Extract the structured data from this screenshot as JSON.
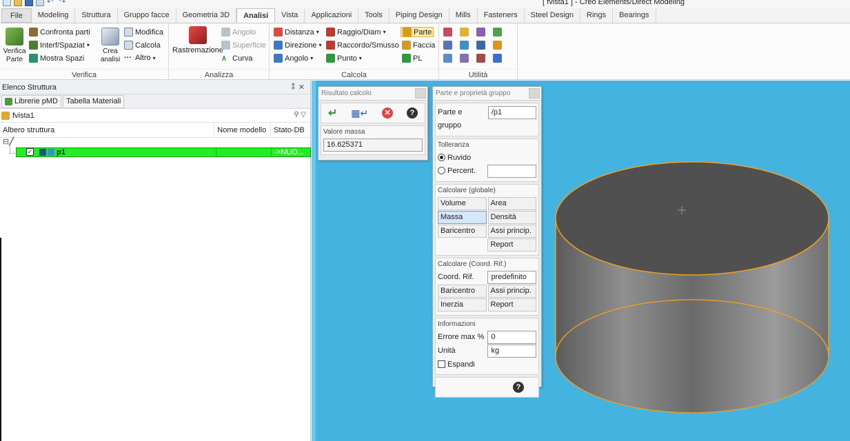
{
  "window": {
    "title": "[ fvista1 ] - Creo Elements/Direct Modeling"
  },
  "quick_access": {
    "undo_icon": "undo-icon",
    "redo_icon": "redo-icon"
  },
  "tabs": [
    {
      "label": "File"
    },
    {
      "label": "Modeling"
    },
    {
      "label": "Struttura"
    },
    {
      "label": "Gruppo facce"
    },
    {
      "label": "Geometria 3D"
    },
    {
      "label": "Analisi"
    },
    {
      "label": "Vista"
    },
    {
      "label": "Applicazioni"
    },
    {
      "label": "Tools"
    },
    {
      "label": "Piping Design"
    },
    {
      "label": "Mills"
    },
    {
      "label": "Fasteners"
    },
    {
      "label": "Steel Design"
    },
    {
      "label": "Rings"
    },
    {
      "label": "Bearings"
    }
  ],
  "ribbon": {
    "verifica": {
      "label": "Verifica",
      "verifica_parte": "Verifica\nParte",
      "confronta_parti": "Confronta parti",
      "interf_spaziat": "Interf/Spaziat",
      "mostra_spazi": "Mostra Spazi",
      "crea_analisi": "Crea\nanalisi",
      "modifica": "Modifica",
      "calcola": "Calcola",
      "altro": "Altro"
    },
    "analizza": {
      "label": "Analizza",
      "rastremazione": "Rastremazione",
      "angolo": "Angolo",
      "superficie": "Superficie",
      "curva": "Curva"
    },
    "calcola": {
      "label": "Calcola",
      "distanza": "Distanza",
      "direzione": "Direzione",
      "angolo": "Angolo",
      "raggio_diam": "Raggio/Diam",
      "raccordo_smusso": "Raccordo/Smusso",
      "punto": "Punto",
      "parte": "Parte",
      "faccia": "Faccia",
      "pl": "PL"
    },
    "utilita": {
      "label": "Utilità"
    }
  },
  "left_panel": {
    "title": "Elenco Struttura",
    "pin": "⁑",
    "close": "✕",
    "tabs": [
      "Librerie pMD",
      "Tabella Materiali"
    ],
    "root": "fvista1",
    "columns": [
      "Albero struttura",
      "Nome modello",
      "Stato-DB"
    ],
    "selected_item": {
      "name": "p1",
      "status": "->NUO..."
    }
  },
  "result_dialog": {
    "title": "Risultato calcolo",
    "section_title": "Valore massa",
    "value": "16.625371"
  },
  "props_dialog": {
    "title": "Parte e proprietà gruppo",
    "part_label": "Parte e gruppo",
    "part_value": "/p1",
    "tolerance_title": "Tolleranza",
    "rough": "Ruvido",
    "percent": "Percent.",
    "global_title": "Calcolare (globale)",
    "volume": "Volume",
    "area": "Area",
    "mass": "Massa",
    "density": "Densità",
    "centroid": "Baricentro",
    "principal_axes": "Assi princip.",
    "report": "Report",
    "coord_title": "Calcolare (Coord. Rif.)",
    "coord_ref": "Coord. Rif.",
    "coord_ref_value": "predefinito",
    "centroid2": "Baricentro",
    "principal_axes2": "Assi princip.",
    "inertia": "Inerzia",
    "report2": "Report",
    "info_title": "Informazioni",
    "max_error_label": "Errore max %",
    "max_error_value": "0",
    "units_label": "Unità",
    "units_value": "kg",
    "expand": "Espandi"
  },
  "colors": {
    "viewport": "#45b3e0",
    "selection": "#22ee22",
    "edge": "#f0a020"
  }
}
